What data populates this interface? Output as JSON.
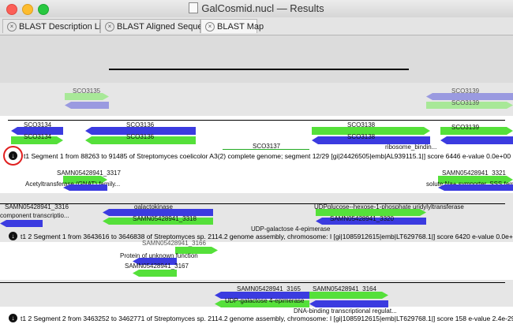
{
  "window": {
    "title": "GalCosmid.nucl — Results"
  },
  "tabs": [
    {
      "label": "BLAST Description List",
      "active": false
    },
    {
      "label": "BLAST Aligned Sequence",
      "active": false
    },
    {
      "label": "BLAST Map",
      "active": true
    }
  ],
  "colors": {
    "forward_gene": "#55e03a",
    "reverse_gene": "#3b3be0",
    "faded_forward": "#a8e898",
    "faded_reverse": "#9a9ae0",
    "highlight": "#e02020"
  },
  "query": {
    "top_labels": [
      "SCO3135",
      "SCO3139"
    ],
    "labels": [
      "SCO3134",
      "SCO3134",
      "SCO3136",
      "SCO3136",
      "SCO3138",
      "SCO3138",
      "SCO3137",
      "SCO3139",
      "ribosome_bindin..."
    ]
  },
  "hits": [
    {
      "label": "t1 Segment 1 from 88263 to 91485 of Streptomyces coelicolor A3(2) complete genome; segment 12/29 [gi|24426505|emb|AL939115.1|] score 6446 e-value 0.0e+00",
      "genes": [
        "SAMN05428941_3317",
        "Acetyltransferase (GNAT) family...",
        "SAMN05428941_3321",
        "solute:Na+ symporter, SSS family",
        "SAMN05428941_3316",
        "component transcriptio...",
        "galactokinase",
        "SAMN05428941_3318",
        "UDPglucose--hexose-1-phosphate uridylyltransferase",
        "SAMN05428941_3320",
        "UDP-galactose 4-epimerase"
      ]
    },
    {
      "label": "t1 2 Segment 1 from 3643616 to 3646838 of Streptomyces sp. 2114.2 genome assembly, chromosome: I [gi|1085912615|emb|LT629768.1|] score 6420 e-value 0.0e+00",
      "genes": [
        "SAMN05428941_3166",
        "Protein of unknown function",
        "SAMN05428941_3167",
        "SAMN05428941_3165",
        "UDP-galactose 4-epimerase",
        "SAMN05428941_3164",
        "DNA-binding transcriptional regulat..."
      ]
    },
    {
      "label": "t1 2 Segment 2 from 3463252 to 3462771 of Streptomyces sp. 2114.2 genome assembly, chromosome: I [gi|1085912615|emb|LT629768.1|] score 158 e-value 2.4e-29"
    }
  ]
}
